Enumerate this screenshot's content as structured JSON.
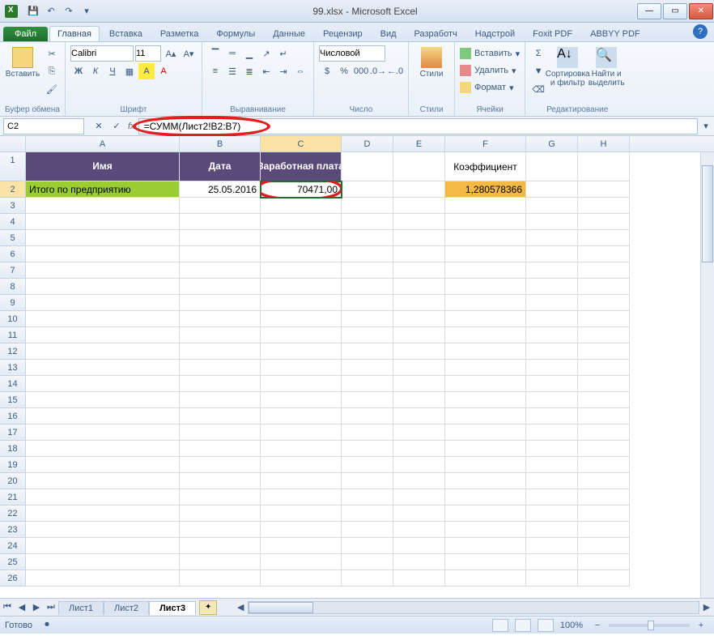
{
  "title": "99.xlsx - Microsoft Excel",
  "qat": {
    "save": "💾",
    "undo": "↶",
    "redo": "↷"
  },
  "tabs": {
    "file": "Файл",
    "items": [
      "Главная",
      "Вставка",
      "Разметка",
      "Формулы",
      "Данные",
      "Рецензир",
      "Вид",
      "Разработч",
      "Надстрой",
      "Foxit PDF",
      "ABBYY PDF"
    ],
    "active": 0
  },
  "ribbon": {
    "clipboard": {
      "label": "Буфер обмена",
      "paste": "Вставить"
    },
    "font": {
      "label": "Шрифт",
      "name": "Calibri",
      "size": "11"
    },
    "align": {
      "label": "Выравнивание"
    },
    "number": {
      "label": "Число",
      "format": "Числовой"
    },
    "styles": {
      "label": "Стили",
      "btn": "Стили"
    },
    "cells": {
      "label": "Ячейки",
      "insert": "Вставить",
      "delete": "Удалить",
      "format": "Формат"
    },
    "editing": {
      "label": "Редактирование",
      "sort": "Сортировка и фильтр",
      "find": "Найти и выделить"
    }
  },
  "namebox": "C2",
  "formula": "=СУММ(Лист2!B2:B7)",
  "columns": [
    "A",
    "B",
    "C",
    "D",
    "E",
    "F",
    "G",
    "H"
  ],
  "rownums": [
    "1",
    "2",
    "3",
    "4",
    "5",
    "6",
    "7",
    "8",
    "9",
    "10",
    "11",
    "12",
    "13",
    "14",
    "15",
    "16",
    "17",
    "18",
    "19",
    "20",
    "21",
    "22",
    "23",
    "24",
    "25",
    "26"
  ],
  "headers": {
    "A": "Имя",
    "B": "Дата",
    "C": "Заработная плата",
    "F": "Коэффициент"
  },
  "row2": {
    "A": "Итого по предприятию",
    "B": "25.05.2016",
    "C": "70471,00",
    "F": "1,280578366"
  },
  "sheets": {
    "items": [
      "Лист1",
      "Лист2",
      "Лист3"
    ],
    "active": 2
  },
  "status": {
    "ready": "Готово",
    "zoom": "100%"
  }
}
